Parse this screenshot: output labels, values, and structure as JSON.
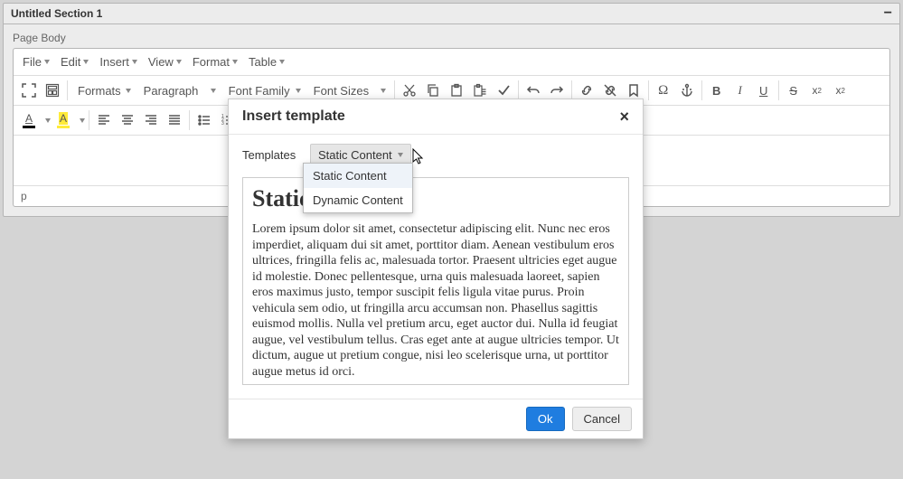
{
  "panel": {
    "title": "Untitled Section 1",
    "page_label": "Page Body"
  },
  "menubar": [
    "File",
    "Edit",
    "Insert",
    "View",
    "Format",
    "Table"
  ],
  "toolbar": {
    "formats": "Formats",
    "block": "Paragraph",
    "font_family": "Font Family",
    "font_size": "Font Sizes"
  },
  "statusbar": {
    "path": "p"
  },
  "modal": {
    "title": "Insert template",
    "label": "Templates",
    "selected": "Static Content",
    "options": [
      "Static Content",
      "Dynamic Content"
    ],
    "preview_title": "Static Content",
    "preview_body": "Lorem ipsum dolor sit amet, consectetur adipiscing elit. Nunc nec eros imperdiet, aliquam dui sit amet, porttitor diam. Aenean vestibulum eros ultrices, fringilla felis ac, malesuada tortor. Praesent ultricies eget augue id molestie. Donec pellentesque, urna quis malesuada laoreet, sapien eros maximus justo, tempor suscipit felis ligula vitae purus. Proin vehicula sem odio, ut fringilla arcu accumsan non. Phasellus sagittis euismod mollis. Nulla vel pretium arcu, eget auctor dui. Nulla id feugiat augue, vel vestibulum tellus. Cras eget ante at augue ultricies tempor. Ut dictum, augue ut pretium congue, nisi leo scelerisque urna, ut porttitor augue metus id orci.",
    "ok": "Ok",
    "cancel": "Cancel"
  }
}
